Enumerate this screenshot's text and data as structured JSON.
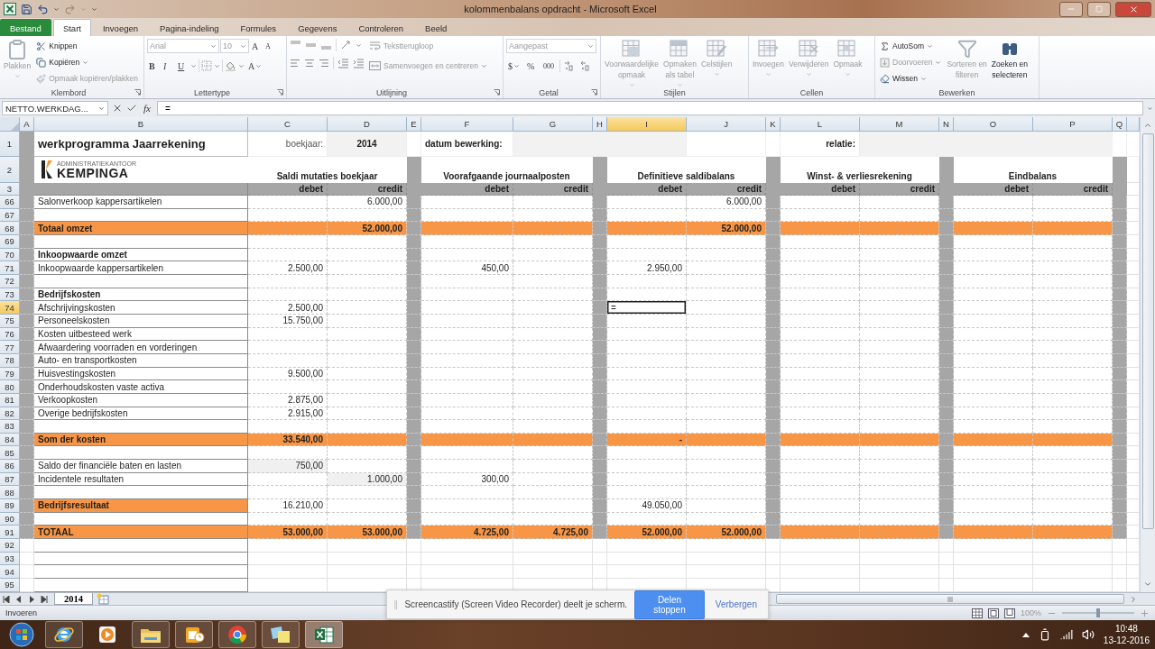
{
  "title_bar": {
    "title": "kolommenbalans opdracht  -  Microsoft Excel"
  },
  "ribbon": {
    "tabs": [
      {
        "label": "Bestand",
        "kind": "file",
        "selected": false
      },
      {
        "label": "Start",
        "kind": "tab",
        "selected": true
      },
      {
        "label": "Invoegen",
        "kind": "tab",
        "selected": false
      },
      {
        "label": "Pagina-indeling",
        "kind": "tab",
        "selected": false
      },
      {
        "label": "Formules",
        "kind": "tab",
        "selected": false
      },
      {
        "label": "Gegevens",
        "kind": "tab",
        "selected": false
      },
      {
        "label": "Controleren",
        "kind": "tab",
        "selected": false
      },
      {
        "label": "Beeld",
        "kind": "tab",
        "selected": false
      }
    ],
    "clipboard": {
      "label": "Klembord",
      "paste": {
        "label": "Plakken",
        "disabled": true
      },
      "cut": {
        "label": "Knippen",
        "disabled": false
      },
      "copy": {
        "label": "Kopiëren",
        "disabled": false
      },
      "format_painter": {
        "label": "Opmaak kopiëren/plakken",
        "disabled": true
      }
    },
    "font": {
      "label": "Lettertype",
      "disabled": true,
      "name": "Arial",
      "size": "10",
      "grow": "A",
      "shrink": "A",
      "bold": "B",
      "italic": "I",
      "underline": "U",
      "color_button": "A"
    },
    "alignment": {
      "label": "Uitlijning",
      "disabled": true,
      "wrap": "Tekstterugloop",
      "merge": "Samenvoegen en centreren"
    },
    "number": {
      "label": "Getal",
      "disabled": true,
      "format": "Aangepast",
      "currency": "$",
      "percent": "%",
      "thousands": "000"
    },
    "styles": {
      "label": "Stijlen",
      "buttons": [
        {
          "lines": [
            "Voorwaardelijke",
            "opmaak"
          ],
          "disabled": true
        },
        {
          "lines": [
            "Opmaken",
            "als tabel"
          ],
          "disabled": true
        },
        {
          "lines": [
            "Celstijlen"
          ],
          "disabled": true
        }
      ]
    },
    "cells": {
      "label": "Cellen",
      "buttons": [
        {
          "lines": [
            "Invoegen"
          ],
          "disabled": true
        },
        {
          "lines": [
            "Verwijderen"
          ],
          "disabled": true
        },
        {
          "lines": [
            "Opmaak"
          ],
          "disabled": true
        }
      ]
    },
    "editing": {
      "label": "Bewerken",
      "autosum": {
        "label": "AutoSom",
        "disabled": false
      },
      "fill": {
        "label": "Doorvoeren",
        "disabled": true
      },
      "clear": {
        "label": "Wissen",
        "disabled": false
      },
      "sort": {
        "lines": [
          "Sorteren en",
          "filteren"
        ],
        "disabled": true
      },
      "find": {
        "lines": [
          "Zoeken en",
          "selecteren"
        ],
        "disabled": false
      }
    }
  },
  "formula_bar": {
    "name_box": "NETTO.WERKDAG...",
    "fx": "fx",
    "value": "="
  },
  "sheet": {
    "columns": [
      {
        "label": "A",
        "selected": false
      },
      {
        "label": "B",
        "selected": false
      },
      {
        "label": "C",
        "selected": false
      },
      {
        "label": "D",
        "selected": false
      },
      {
        "label": "E",
        "selected": false
      },
      {
        "label": "F",
        "selected": false
      },
      {
        "label": "G",
        "selected": false
      },
      {
        "label": "H",
        "selected": false
      },
      {
        "label": "I",
        "selected": true
      },
      {
        "label": "J",
        "selected": false
      },
      {
        "label": "K",
        "selected": false
      },
      {
        "label": "L",
        "selected": false
      },
      {
        "label": "M",
        "selected": false
      },
      {
        "label": "N",
        "selected": false
      },
      {
        "label": "O",
        "selected": false
      },
      {
        "label": "P",
        "selected": false
      },
      {
        "label": "Q",
        "selected": false
      }
    ],
    "title": "werkprogramma Jaarrekening",
    "year_label": "boekjaar:",
    "year": "2014",
    "date_label": "datum bewerking:",
    "relation_label": "relatie:",
    "logo": {
      "caption": "ADMINISTRATIEKANTOOR",
      "name": "KEMPINGA"
    },
    "sections": [
      {
        "title": "Saldi mutaties boekjaar",
        "debit": "debet",
        "credit": "credit"
      },
      {
        "title": "Voorafgaande journaalposten",
        "debit": "debet",
        "credit": "credit"
      },
      {
        "title": "Definitieve saldibalans",
        "debit": "debet",
        "credit": "credit"
      },
      {
        "title": "Winst- & verliesrekening",
        "debit": "debet",
        "credit": "credit"
      },
      {
        "title": "Eindbalans",
        "debit": "debet",
        "credit": "credit"
      }
    ],
    "top_rows": [
      {
        "number": "1",
        "selected": false
      },
      {
        "number": "2",
        "selected": false
      },
      {
        "number": "3",
        "selected": false
      }
    ],
    "rows": [
      {
        "number": "66",
        "kind": "item",
        "selected": false,
        "cells": {
          "B": "Salonverkoop kappersartikelen",
          "D": "6.000,00",
          "J": "6.000,00"
        }
      },
      {
        "number": "67",
        "kind": "item",
        "selected": false,
        "cells": {}
      },
      {
        "number": "68",
        "kind": "total",
        "selected": false,
        "cells": {
          "B": "Totaal omzet",
          "D": "52.000,00",
          "J": "52.000,00"
        }
      },
      {
        "number": "69",
        "kind": "item",
        "selected": false,
        "cells": {}
      },
      {
        "number": "70",
        "kind": "heading",
        "selected": false,
        "cells": {
          "B": "Inkoopwaarde omzet"
        }
      },
      {
        "number": "71",
        "kind": "item",
        "selected": false,
        "cells": {
          "B": "Inkoopwaarde kappersartikelen",
          "C": "2.500,00",
          "F": "450,00",
          "I": "2.950,00"
        }
      },
      {
        "number": "72",
        "kind": "item",
        "selected": false,
        "cells": {}
      },
      {
        "number": "73",
        "kind": "heading",
        "selected": false,
        "cells": {
          "B": "Bedrijfskosten"
        }
      },
      {
        "number": "74",
        "kind": "item",
        "selected": true,
        "cells": {
          "B": "Afschrijvingskosten",
          "C": "2.500,00",
          "I": {
            "text": "=",
            "active": true
          }
        }
      },
      {
        "number": "75",
        "kind": "item",
        "selected": false,
        "cells": {
          "B": "Personeelskosten",
          "C": "15.750,00"
        }
      },
      {
        "number": "76",
        "kind": "item",
        "selected": false,
        "cells": {
          "B": "Kosten uitbesteed werk"
        }
      },
      {
        "number": "77",
        "kind": "item",
        "selected": false,
        "cells": {
          "B": "Afwaardering voorraden en vorderingen"
        }
      },
      {
        "number": "78",
        "kind": "item",
        "selected": false,
        "cells": {
          "B": "Auto- en transportkosten"
        }
      },
      {
        "number": "79",
        "kind": "item",
        "selected": false,
        "cells": {
          "B": "Huisvestingskosten",
          "C": "9.500,00"
        }
      },
      {
        "number": "80",
        "kind": "item",
        "selected": false,
        "cells": {
          "B": "Onderhoudskosten vaste activa"
        }
      },
      {
        "number": "81",
        "kind": "item",
        "selected": false,
        "cells": {
          "B": "Verkoopkosten",
          "C": "2.875,00"
        }
      },
      {
        "number": "82",
        "kind": "item",
        "selected": false,
        "cells": {
          "B": "Overige bedrijfskosten",
          "C": "2.915,00"
        }
      },
      {
        "number": "83",
        "kind": "item",
        "selected": false,
        "cells": {}
      },
      {
        "number": "84",
        "kind": "total",
        "selected": false,
        "cells": {
          "B": "Som der kosten",
          "C": "33.540,00",
          "I": "-"
        }
      },
      {
        "number": "85",
        "kind": "item",
        "selected": false,
        "cells": {}
      },
      {
        "number": "86",
        "kind": "item",
        "selected": false,
        "cells": {
          "B": "Saldo der financiële baten en lasten",
          "C": {
            "text": "750,00",
            "shaded": true
          }
        }
      },
      {
        "number": "87",
        "kind": "item",
        "selected": false,
        "cells": {
          "B": "Incidentele resultaten",
          "D": {
            "text": "1.000,00",
            "shaded": true
          },
          "F": "300,00"
        }
      },
      {
        "number": "88",
        "kind": "item",
        "selected": false,
        "cells": {}
      },
      {
        "number": "89",
        "kind": "result",
        "selected": false,
        "cells": {
          "B": "Bedrijfsresultaat",
          "C": "16.210,00",
          "I": "49.050,00"
        }
      },
      {
        "number": "90",
        "kind": "item",
        "selected": false,
        "cells": {}
      },
      {
        "number": "91",
        "kind": "total",
        "selected": false,
        "cells": {
          "B": "TOTAAL",
          "C": "53.000,00",
          "D": "53.000,00",
          "F": "4.725,00",
          "G": "4.725,00",
          "I": "52.000,00",
          "J": "52.000,00"
        }
      },
      {
        "number": "92",
        "kind": "empty",
        "selected": false,
        "cells": {}
      },
      {
        "number": "93",
        "kind": "empty",
        "selected": false,
        "cells": {}
      },
      {
        "number": "94",
        "kind": "empty",
        "selected": false,
        "cells": {}
      },
      {
        "number": "95",
        "kind": "empty",
        "selected": false,
        "cells": {}
      }
    ]
  },
  "sheet_tabs": [
    {
      "label": "2014",
      "selected": true
    }
  ],
  "status_bar": {
    "mode": "Invoeren",
    "zoom": "100%",
    "zoom_slider": {
      "level": 0.5
    }
  },
  "notification": {
    "message": "Screencastify (Screen Video Recorder) deelt je scherm.",
    "stop": "Delen stoppen",
    "hide": "Verbergen"
  },
  "taskbar": {
    "apps": [
      {
        "kind": "browser",
        "running": true,
        "active": false
      },
      {
        "kind": "player",
        "running": false,
        "active": false
      },
      {
        "kind": "files",
        "running": true,
        "active": false
      },
      {
        "kind": "mail",
        "running": true,
        "active": false
      },
      {
        "kind": "webbrowser",
        "running": true,
        "active": false
      },
      {
        "kind": "notes",
        "running": true,
        "active": false
      },
      {
        "kind": "spreadsheet",
        "running": true,
        "active": true
      }
    ],
    "time": "10:48",
    "date": "13-12-2016"
  }
}
